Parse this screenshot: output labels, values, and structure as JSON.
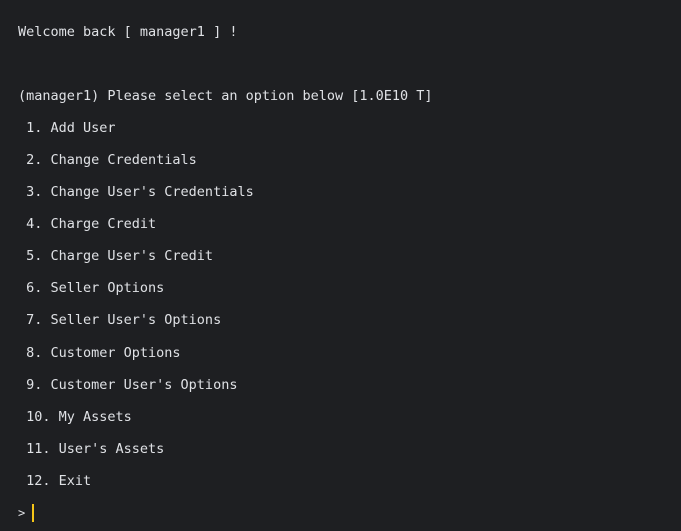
{
  "terminal": {
    "welcome": "Welcome back [ manager1 ] !",
    "prompt_header": "(manager1) Please select an option below [1.0E10 T]",
    "menu_items": [
      " 1. Add User",
      " 2. Change Credentials",
      " 3. Change User's Credentials",
      " 4. Charge Credit",
      " 5. Charge User's Credit",
      " 6. Seller Options",
      " 7. Seller User's Options",
      " 8. Customer Options",
      " 9. Customer User's Options",
      " 10. My Assets",
      " 11. User's Assets",
      " 12. Exit"
    ],
    "input_prompt": ">",
    "input_value": "",
    "caret_color": "#f5c518",
    "background_color": "#1e1f22",
    "text_color": "#dfe1e5"
  }
}
